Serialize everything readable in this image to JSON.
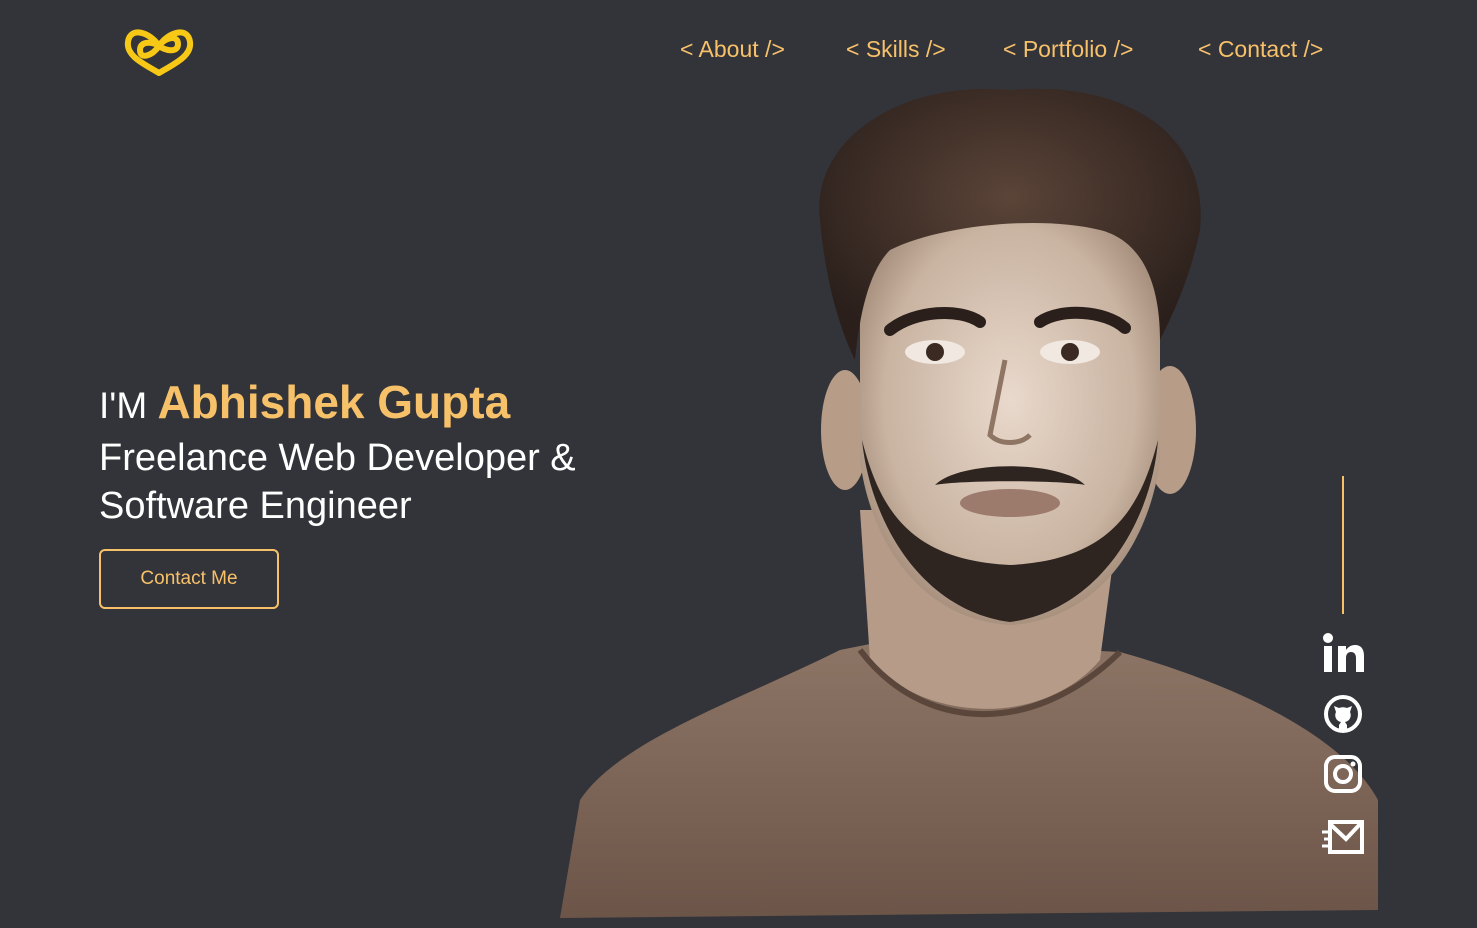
{
  "logo": {
    "icon": "infinity-heart-logo",
    "color": "#f7c816"
  },
  "nav": {
    "items": [
      {
        "label": "< About />"
      },
      {
        "label": "< Skills />"
      },
      {
        "label": "< Portfolio />"
      },
      {
        "label": "< Contact />"
      }
    ]
  },
  "hero": {
    "greeting_prefix": "I'M",
    "name": "Abhishek Gupta",
    "role_line1": "Freelance Web Developer &",
    "role_line2": "Software Engineer",
    "cta_label": "Contact Me"
  },
  "portrait": {
    "description_icon": "profile-photo"
  },
  "social": {
    "icons": [
      "linkedin-icon",
      "github-icon",
      "instagram-icon",
      "email-icon"
    ]
  },
  "colors": {
    "background": "#333439",
    "accent": "#f7c16a",
    "text": "#ffffff"
  }
}
